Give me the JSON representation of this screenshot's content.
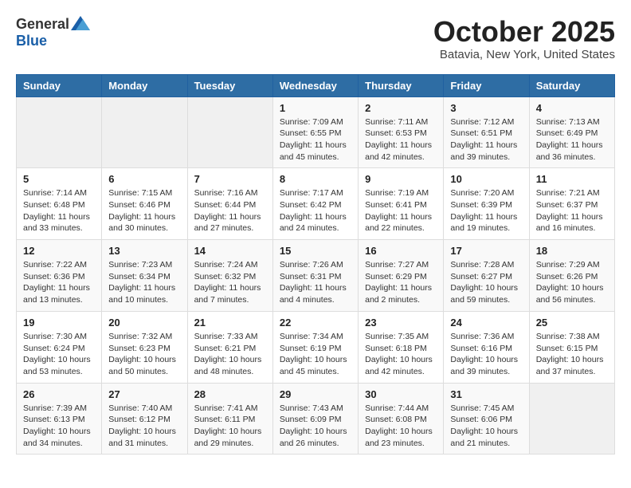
{
  "logo": {
    "general": "General",
    "blue": "Blue"
  },
  "title": {
    "month": "October 2025",
    "location": "Batavia, New York, United States"
  },
  "weekdays": [
    "Sunday",
    "Monday",
    "Tuesday",
    "Wednesday",
    "Thursday",
    "Friday",
    "Saturday"
  ],
  "weeks": [
    [
      {
        "day": "",
        "info": ""
      },
      {
        "day": "",
        "info": ""
      },
      {
        "day": "",
        "info": ""
      },
      {
        "day": "1",
        "info": "Sunrise: 7:09 AM\nSunset: 6:55 PM\nDaylight: 11 hours\nand 45 minutes."
      },
      {
        "day": "2",
        "info": "Sunrise: 7:11 AM\nSunset: 6:53 PM\nDaylight: 11 hours\nand 42 minutes."
      },
      {
        "day": "3",
        "info": "Sunrise: 7:12 AM\nSunset: 6:51 PM\nDaylight: 11 hours\nand 39 minutes."
      },
      {
        "day": "4",
        "info": "Sunrise: 7:13 AM\nSunset: 6:49 PM\nDaylight: 11 hours\nand 36 minutes."
      }
    ],
    [
      {
        "day": "5",
        "info": "Sunrise: 7:14 AM\nSunset: 6:48 PM\nDaylight: 11 hours\nand 33 minutes."
      },
      {
        "day": "6",
        "info": "Sunrise: 7:15 AM\nSunset: 6:46 PM\nDaylight: 11 hours\nand 30 minutes."
      },
      {
        "day": "7",
        "info": "Sunrise: 7:16 AM\nSunset: 6:44 PM\nDaylight: 11 hours\nand 27 minutes."
      },
      {
        "day": "8",
        "info": "Sunrise: 7:17 AM\nSunset: 6:42 PM\nDaylight: 11 hours\nand 24 minutes."
      },
      {
        "day": "9",
        "info": "Sunrise: 7:19 AM\nSunset: 6:41 PM\nDaylight: 11 hours\nand 22 minutes."
      },
      {
        "day": "10",
        "info": "Sunrise: 7:20 AM\nSunset: 6:39 PM\nDaylight: 11 hours\nand 19 minutes."
      },
      {
        "day": "11",
        "info": "Sunrise: 7:21 AM\nSunset: 6:37 PM\nDaylight: 11 hours\nand 16 minutes."
      }
    ],
    [
      {
        "day": "12",
        "info": "Sunrise: 7:22 AM\nSunset: 6:36 PM\nDaylight: 11 hours\nand 13 minutes."
      },
      {
        "day": "13",
        "info": "Sunrise: 7:23 AM\nSunset: 6:34 PM\nDaylight: 11 hours\nand 10 minutes."
      },
      {
        "day": "14",
        "info": "Sunrise: 7:24 AM\nSunset: 6:32 PM\nDaylight: 11 hours\nand 7 minutes."
      },
      {
        "day": "15",
        "info": "Sunrise: 7:26 AM\nSunset: 6:31 PM\nDaylight: 11 hours\nand 4 minutes."
      },
      {
        "day": "16",
        "info": "Sunrise: 7:27 AM\nSunset: 6:29 PM\nDaylight: 11 hours\nand 2 minutes."
      },
      {
        "day": "17",
        "info": "Sunrise: 7:28 AM\nSunset: 6:27 PM\nDaylight: 10 hours\nand 59 minutes."
      },
      {
        "day": "18",
        "info": "Sunrise: 7:29 AM\nSunset: 6:26 PM\nDaylight: 10 hours\nand 56 minutes."
      }
    ],
    [
      {
        "day": "19",
        "info": "Sunrise: 7:30 AM\nSunset: 6:24 PM\nDaylight: 10 hours\nand 53 minutes."
      },
      {
        "day": "20",
        "info": "Sunrise: 7:32 AM\nSunset: 6:23 PM\nDaylight: 10 hours\nand 50 minutes."
      },
      {
        "day": "21",
        "info": "Sunrise: 7:33 AM\nSunset: 6:21 PM\nDaylight: 10 hours\nand 48 minutes."
      },
      {
        "day": "22",
        "info": "Sunrise: 7:34 AM\nSunset: 6:19 PM\nDaylight: 10 hours\nand 45 minutes."
      },
      {
        "day": "23",
        "info": "Sunrise: 7:35 AM\nSunset: 6:18 PM\nDaylight: 10 hours\nand 42 minutes."
      },
      {
        "day": "24",
        "info": "Sunrise: 7:36 AM\nSunset: 6:16 PM\nDaylight: 10 hours\nand 39 minutes."
      },
      {
        "day": "25",
        "info": "Sunrise: 7:38 AM\nSunset: 6:15 PM\nDaylight: 10 hours\nand 37 minutes."
      }
    ],
    [
      {
        "day": "26",
        "info": "Sunrise: 7:39 AM\nSunset: 6:13 PM\nDaylight: 10 hours\nand 34 minutes."
      },
      {
        "day": "27",
        "info": "Sunrise: 7:40 AM\nSunset: 6:12 PM\nDaylight: 10 hours\nand 31 minutes."
      },
      {
        "day": "28",
        "info": "Sunrise: 7:41 AM\nSunset: 6:11 PM\nDaylight: 10 hours\nand 29 minutes."
      },
      {
        "day": "29",
        "info": "Sunrise: 7:43 AM\nSunset: 6:09 PM\nDaylight: 10 hours\nand 26 minutes."
      },
      {
        "day": "30",
        "info": "Sunrise: 7:44 AM\nSunset: 6:08 PM\nDaylight: 10 hours\nand 23 minutes."
      },
      {
        "day": "31",
        "info": "Sunrise: 7:45 AM\nSunset: 6:06 PM\nDaylight: 10 hours\nand 21 minutes."
      },
      {
        "day": "",
        "info": ""
      }
    ]
  ]
}
